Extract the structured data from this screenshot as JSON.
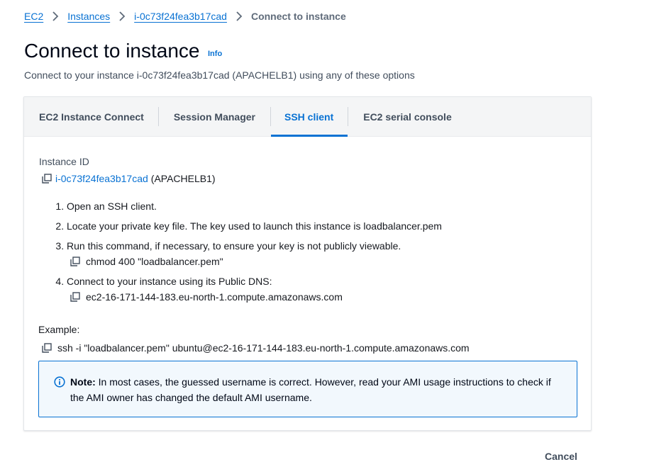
{
  "breadcrumb": {
    "items": [
      "EC2",
      "Instances",
      "i-0c73f24fea3b17cad"
    ],
    "current": "Connect to instance"
  },
  "header": {
    "title": "Connect to instance",
    "info": "Info",
    "description": "Connect to your instance i-0c73f24fea3b17cad (APACHELB1) using any of these options"
  },
  "tabs": [
    {
      "label": "EC2 Instance Connect",
      "active": false
    },
    {
      "label": "Session Manager",
      "active": false
    },
    {
      "label": "SSH client",
      "active": true
    },
    {
      "label": "EC2 serial console",
      "active": false
    }
  ],
  "instance": {
    "label": "Instance ID",
    "id": "i-0c73f24fea3b17cad",
    "name": "(APACHELB1)"
  },
  "steps": [
    {
      "text": "Open an SSH client."
    },
    {
      "text": "Locate your private key file. The key used to launch this instance is loadbalancer.pem"
    },
    {
      "text": "Run this command, if necessary, to ensure your key is not publicly viewable.",
      "command": "chmod 400 \"loadbalancer.pem\""
    },
    {
      "text": "Connect to your instance using its Public DNS:",
      "command": "ec2-16-171-144-183.eu-north-1.compute.amazonaws.com"
    }
  ],
  "example": {
    "label": "Example:",
    "command": "ssh -i \"loadbalancer.pem\" ubuntu@ec2-16-171-144-183.eu-north-1.compute.amazonaws.com"
  },
  "note": {
    "bold": "Note:",
    "text": " In most cases, the guessed username is correct. However, read your AMI usage instructions to check if the AMI owner has changed the default AMI username."
  },
  "footer": {
    "cancel": "Cancel"
  },
  "colors": {
    "link": "#0972d3",
    "text": "#16191f",
    "muted": "#414d5c",
    "note_bg": "#f2f8fd"
  }
}
